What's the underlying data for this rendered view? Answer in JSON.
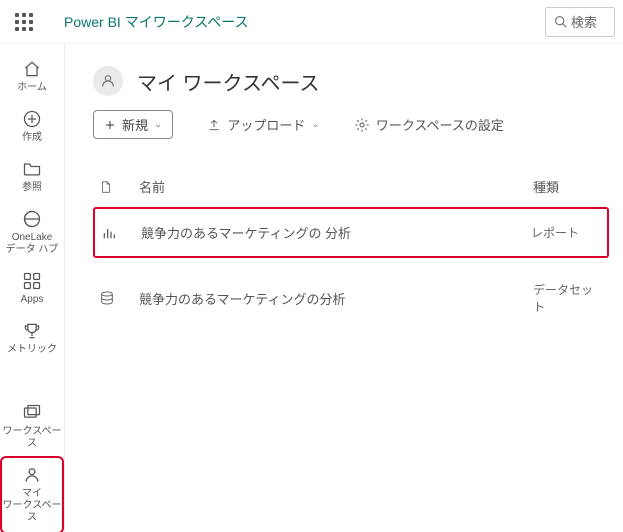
{
  "top": {
    "app_title": "Power BI マイワークスペース"
  },
  "search": {
    "placeholder": "検索"
  },
  "sidebar": {
    "items": [
      {
        "label": "ホーム"
      },
      {
        "label": "作成"
      },
      {
        "label": "参照"
      },
      {
        "label": "OneLake\nデータ ハブ"
      },
      {
        "label": "Apps"
      },
      {
        "label": "メトリック"
      },
      {
        "label": "ワークスペース"
      },
      {
        "label": "マイ\nワークスペース"
      }
    ]
  },
  "workspace": {
    "title": "マイ ワークスペース"
  },
  "toolbar": {
    "new_label": "新規",
    "upload_label": "アップロード",
    "settings_label": "ワークスペースの設定"
  },
  "list": {
    "headers": {
      "name": "名前",
      "type": "種類"
    },
    "rows": [
      {
        "name": "競争力のあるマーケティングの 分析",
        "type": "レポート"
      },
      {
        "name": "競争力のあるマーケティングの分析",
        "type": "データセット"
      }
    ]
  }
}
